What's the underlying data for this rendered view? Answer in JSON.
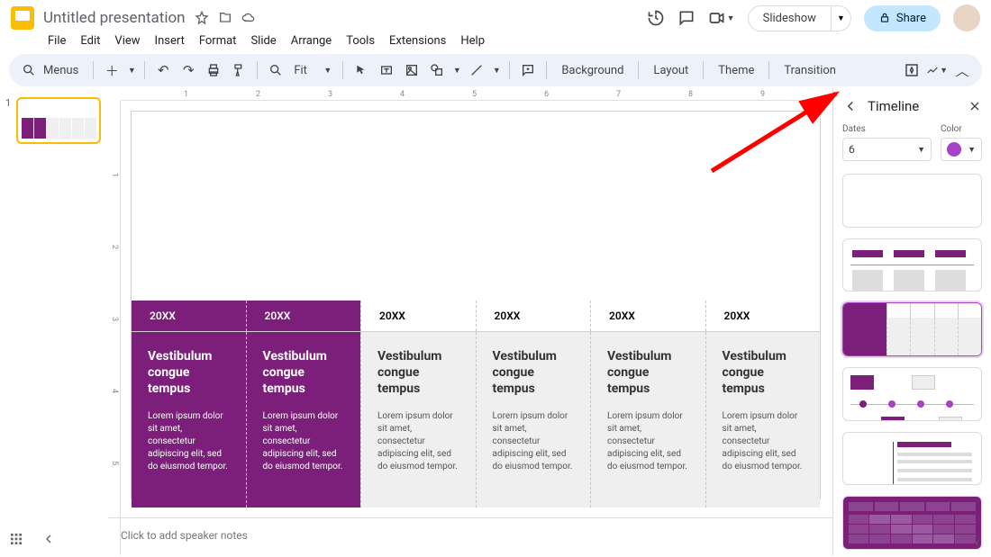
{
  "header": {
    "title": "Untitled presentation",
    "menus": [
      "File",
      "Edit",
      "View",
      "Insert",
      "Format",
      "Slide",
      "Arrange",
      "Tools",
      "Extensions",
      "Help"
    ],
    "slideshow": "Slideshow",
    "share": "Share"
  },
  "toolbar": {
    "menus_label": "Menus",
    "zoom": "Fit",
    "background": "Background",
    "layout": "Layout",
    "theme": "Theme",
    "transition": "Transition"
  },
  "slide": {
    "columns": [
      {
        "year": "20XX",
        "style": "p",
        "heading": "Vestibulum congue tempus",
        "body": "Lorem ipsum dolor sit amet, consectetur adipiscing elit, sed do eiusmod tempor."
      },
      {
        "year": "20XX",
        "style": "p",
        "heading": "Vestibulum congue tempus",
        "body": "Lorem ipsum dolor sit amet, consectetur adipiscing elit, sed do eiusmod tempor."
      },
      {
        "year": "20XX",
        "style": "g",
        "heading": "Vestibulum congue tempus",
        "body": "Lorem ipsum dolor sit amet, consectetur adipiscing elit, sed do eiusmod tempor."
      },
      {
        "year": "20XX",
        "style": "g",
        "heading": "Vestibulum congue tempus",
        "body": "Lorem ipsum dolor sit amet, consectetur adipiscing elit, sed do eiusmod tempor."
      },
      {
        "year": "20XX",
        "style": "g",
        "heading": "Vestibulum congue tempus",
        "body": "Lorem ipsum dolor sit amet, consectetur adipiscing elit, sed do eiusmod tempor."
      },
      {
        "year": "20XX",
        "style": "g",
        "heading": "Vestibulum congue tempus",
        "body": "Lorem ipsum dolor sit amet, consectetur adipiscing elit, sed do eiusmod tempor."
      }
    ],
    "notes_placeholder": "Click to add speaker notes"
  },
  "ruler_h": [
    "",
    "1",
    "2",
    "3",
    "4",
    "5",
    "6",
    "7",
    "8",
    "9"
  ],
  "ruler_v": [
    "",
    "1",
    "2",
    "3",
    "4",
    "5"
  ],
  "filmstrip": {
    "slide_number": "1"
  },
  "sidepanel": {
    "title": "Timeline",
    "dates_label": "Dates",
    "dates_value": "6",
    "color_label": "Color"
  }
}
